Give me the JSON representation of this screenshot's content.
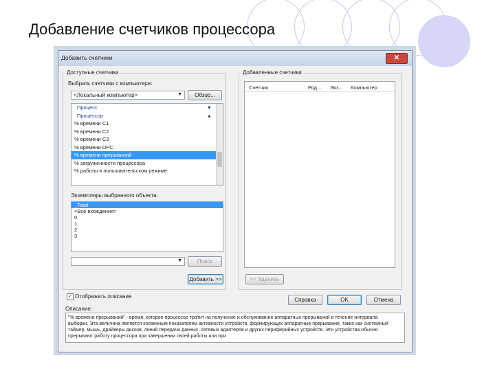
{
  "slide": {
    "title": "Добавление счетчиков процессора"
  },
  "dialog": {
    "title": "Добавить счетчики",
    "close_icon": "close-icon",
    "available": {
      "group_label": "Доступные счетчики",
      "computer_label": "Выбрать счетчики с компьютера:",
      "computer_value": "<Локальный компьютер>",
      "browse_label": "Обзор...",
      "items": [
        {
          "label": "Процесс",
          "kind": "cat",
          "icon": "chevron-down-icon"
        },
        {
          "label": "Процессор",
          "kind": "cat",
          "icon": "chevron-up-icon"
        },
        {
          "label": "% времени C1",
          "kind": "item"
        },
        {
          "label": "% времени C2",
          "kind": "item"
        },
        {
          "label": "% времени C3",
          "kind": "item"
        },
        {
          "label": "% времени DPC",
          "kind": "item"
        },
        {
          "label": "% времени прерываний",
          "kind": "sel"
        },
        {
          "label": "% загруженности процессора",
          "kind": "item"
        },
        {
          "label": "% работы в пользовательском режиме",
          "kind": "item"
        }
      ],
      "instances_label": "Экземпляры выбранного объекта:",
      "instances": [
        "_Total",
        "<Все вхождения>",
        "0",
        "1",
        "2",
        "3"
      ],
      "search_value": "",
      "search_label": "Поиск",
      "add_label": "Добавить >>"
    },
    "added": {
      "group_label": "Добавленные счетчики",
      "columns": [
        "Счетчик",
        "Род...",
        "Экз...",
        "Компьютер"
      ],
      "remove_label": "<< Удалить"
    },
    "show_description_label": "Отображать описание",
    "show_description_checked": true,
    "description_label": "Описание:",
    "description_text": "\"% времени прерываний\" - время, которое процессор тратит на получение и обслуживание аппаратных прерываний в течение интервала выборки. Эта величина является косвенным показателем активности устройств, формирующих аппаратные прерывания, таких как системный таймер, мышь, драйверы дисков, линий передачи данных, сетевых адаптеров и других периферийных устройств. Эти устройства обычно прерывают работу процессора при завершении своей работы или при",
    "buttons": {
      "help": "Справка",
      "ok": "OK",
      "cancel": "Отмена"
    }
  }
}
